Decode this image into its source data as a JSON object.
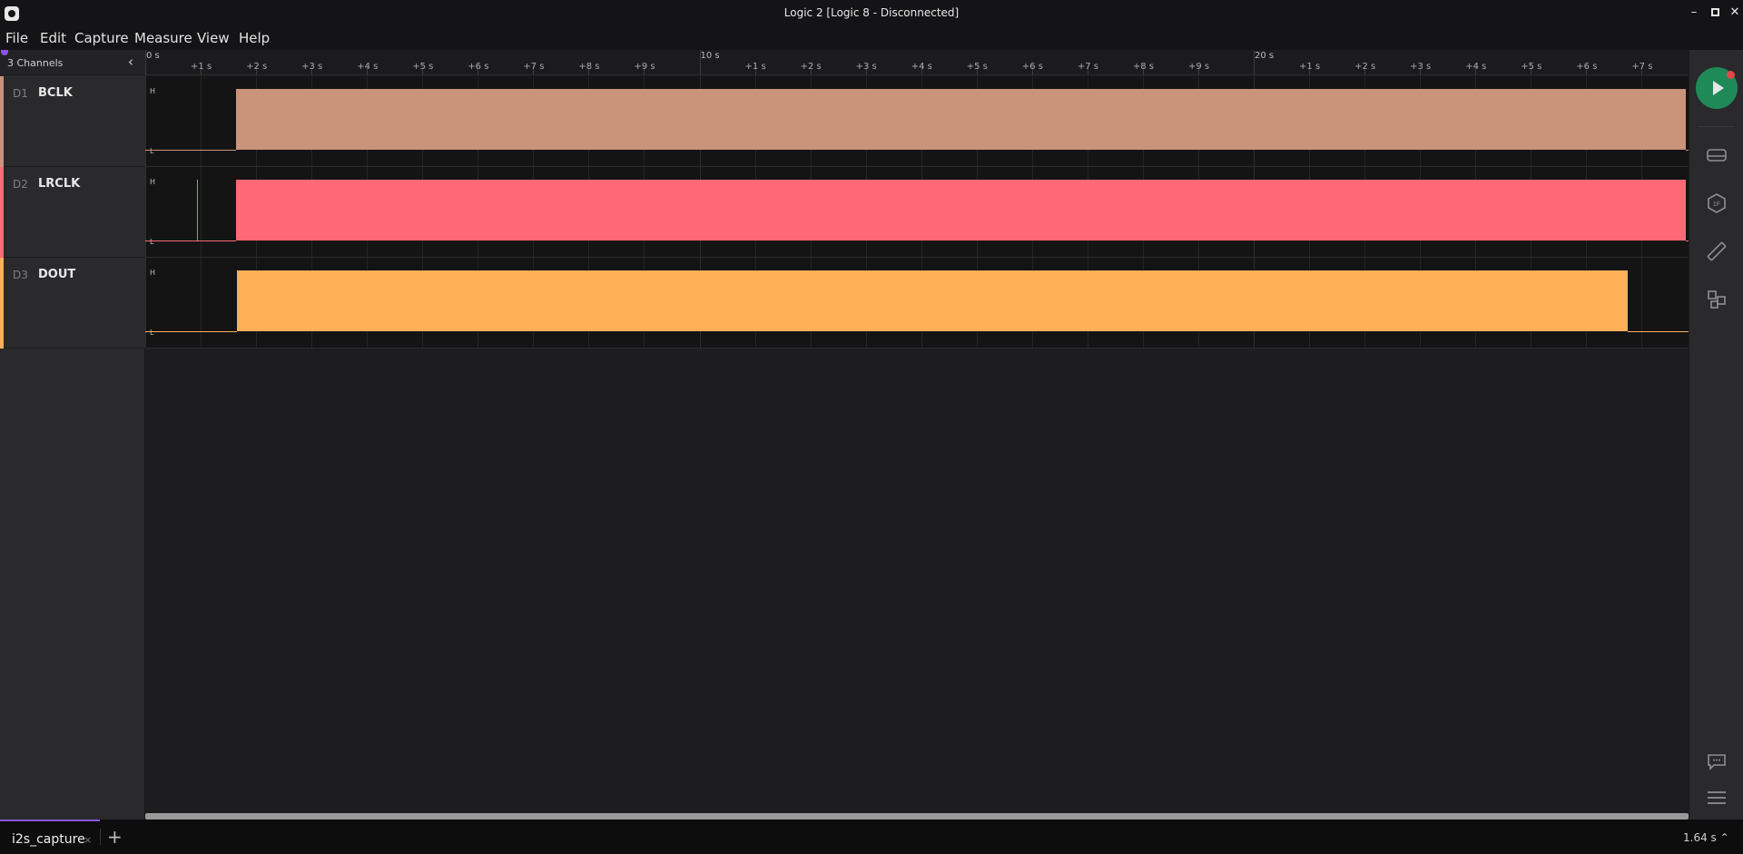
{
  "window": {
    "title": "Logic 2 [Logic 8 - Disconnected]",
    "controls": {
      "minimize": "–",
      "close": "✕"
    }
  },
  "menu": [
    "File",
    "Edit",
    "Capture",
    "Measure",
    "View",
    "Help"
  ],
  "sidebar": {
    "channel_count_label": "3 Channels",
    "collapse_glyph": "‹",
    "channels": [
      {
        "index": "D1",
        "name": "BCLK",
        "color": "#c9947a"
      },
      {
        "index": "D2",
        "name": "LRCLK",
        "color": "#fe6877"
      },
      {
        "index": "D3",
        "name": "DOUT",
        "color": "#feb057"
      }
    ]
  },
  "timeline": {
    "labels": [
      "0 s",
      "+1 s",
      "+2 s",
      "+3 s",
      "+4 s",
      "+5 s",
      "+6 s",
      "+7 s",
      "+8 s",
      "+9 s",
      "10 s",
      "+1 s",
      "+2 s",
      "+3 s",
      "+4 s",
      "+5 s",
      "+6 s",
      "+7 s",
      "+8 s",
      "+9 s",
      "20 s",
      "+1 s",
      "+2 s",
      "+3 s",
      "+4 s",
      "+5 s",
      "+6 s",
      "+7 s"
    ],
    "level_high": "H",
    "level_low": "L",
    "visible_seconds_start": 0,
    "visible_seconds_end": 27.8,
    "signals": [
      {
        "channel": "BCLK",
        "dense_start_s": 1.64,
        "dense_end_s": 27.8,
        "spikes_s": []
      },
      {
        "channel": "LRCLK",
        "dense_start_s": 1.64,
        "dense_end_s": 27.8,
        "spikes_s": [
          0.93
        ]
      },
      {
        "channel": "DOUT",
        "dense_start_s": 1.66,
        "dense_end_s": 26.75,
        "spikes_s": []
      }
    ]
  },
  "toolbar": {
    "run_button": "play-icon",
    "tools": [
      "device-icon",
      "analyzers-icon",
      "measurements-icon",
      "extensions-icon"
    ],
    "bottom_tools": [
      "chat-icon",
      "menu-icon"
    ]
  },
  "tabs": {
    "active": "i2s_capture",
    "close_glyph": "×",
    "add_glyph": "+"
  },
  "status": {
    "time": "1.64 s ⌃"
  }
}
